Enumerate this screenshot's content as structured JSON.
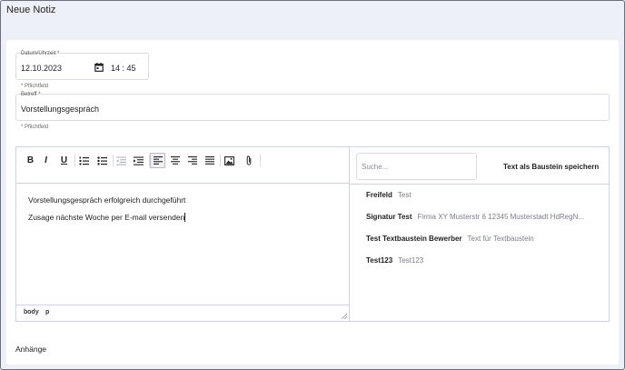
{
  "window": {
    "title": "Neue Notiz"
  },
  "datetime": {
    "label": "Datum/Uhrzeit *",
    "date": "12.10.2023",
    "time": "14 : 45",
    "hint": "* Pflichtfeld"
  },
  "subject": {
    "label": "Betreff *",
    "value": "Vorstellungsgespräch",
    "hint": "* Pflichtfeld"
  },
  "editor": {
    "lines": [
      "Vorstellungsgespräch erfolgreich durchgeführt",
      "Zusage nächste Woche per E-mail versenden"
    ],
    "path": [
      "body",
      "p"
    ],
    "toolbar": {
      "bold": "B",
      "italic": "I",
      "underline": "U"
    }
  },
  "bausteine": {
    "search_placeholder": "Suche...",
    "save_label": "Text als Baustein speichern",
    "items": [
      {
        "name": "Freifeld",
        "text": "Test"
      },
      {
        "name": "Signatur Test",
        "text": "Firma XY Musterstr 6 12345 Musterstadt HdRegN..."
      },
      {
        "name": "Test Textbaustein Bewerber",
        "text": "Text für Textbaustein"
      },
      {
        "name": "Test123",
        "text": "Test123"
      }
    ]
  },
  "attachments": {
    "label": "Anhänge"
  }
}
